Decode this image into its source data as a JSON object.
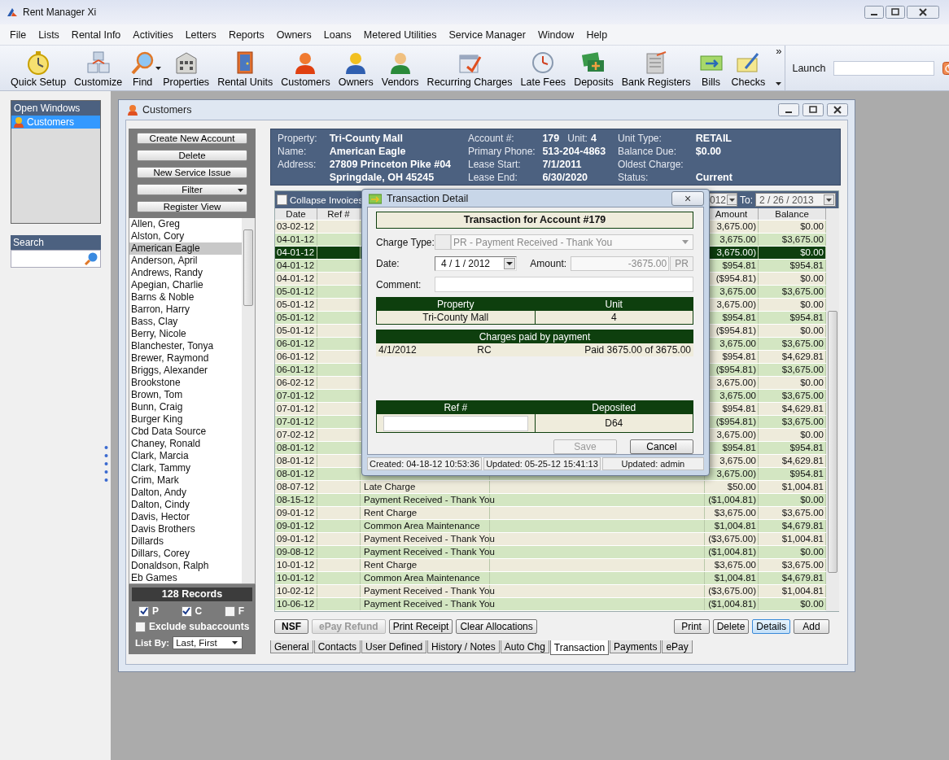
{
  "window": {
    "title": "Rent Manager Xi"
  },
  "menu": [
    "File",
    "Lists",
    "Rental Info",
    "Activities",
    "Letters",
    "Reports",
    "Owners",
    "Loans",
    "Metered Utilities",
    "Service Manager",
    "Window",
    "Help"
  ],
  "toolbar": [
    {
      "label": "Quick Setup",
      "has_menu": false
    },
    {
      "label": "Customize",
      "has_menu": false
    },
    {
      "label": "Find",
      "has_menu": true
    },
    {
      "label": "Properties",
      "has_menu": false
    },
    {
      "label": "Rental Units",
      "has_menu": false
    },
    {
      "label": "Customers",
      "has_menu": false
    },
    {
      "label": "Owners",
      "has_menu": false
    },
    {
      "label": "Vendors",
      "has_menu": false
    },
    {
      "label": "Recurring Charges",
      "has_menu": false
    },
    {
      "label": "Late Fees",
      "has_menu": false
    },
    {
      "label": "Deposits",
      "has_menu": false
    },
    {
      "label": "Bank Registers",
      "has_menu": false
    },
    {
      "label": "Bills",
      "has_menu": false
    },
    {
      "label": "Checks",
      "has_menu": false
    }
  ],
  "toolbar_overflow": "»",
  "launch": {
    "label": "Launch"
  },
  "open_windows": {
    "title": "Open Windows",
    "items": [
      {
        "label": "Customers",
        "selected": true
      }
    ]
  },
  "search": {
    "title": "Search"
  },
  "customers_window": {
    "title": "Customers",
    "actions": [
      {
        "label": "Create New Account",
        "has_menu": false
      },
      {
        "label": "Delete",
        "has_menu": false
      },
      {
        "label": "New Service Issue",
        "has_menu": false
      },
      {
        "label": "Filter",
        "has_menu": true
      },
      {
        "label": "Register View",
        "has_menu": false
      }
    ],
    "customer_list": [
      {
        "name": "Allen, Greg",
        "selected": false
      },
      {
        "name": "Alston, Cory",
        "selected": false
      },
      {
        "name": "American Eagle",
        "selected": true
      },
      {
        "name": "Anderson, April",
        "selected": false
      },
      {
        "name": "Andrews, Randy",
        "selected": false
      },
      {
        "name": "Apegian, Charlie",
        "selected": false
      },
      {
        "name": "Barns & Noble",
        "selected": false
      },
      {
        "name": "Barron, Harry",
        "selected": false
      },
      {
        "name": "Bass, Clay",
        "selected": false
      },
      {
        "name": "Berry, Nicole",
        "selected": false
      },
      {
        "name": "Blanchester, Tonya",
        "selected": false
      },
      {
        "name": "Brewer, Raymond",
        "selected": false
      },
      {
        "name": "Briggs, Alexander",
        "selected": false
      },
      {
        "name": "Brookstone",
        "selected": false
      },
      {
        "name": "Brown, Tom",
        "selected": false
      },
      {
        "name": "Bunn, Craig",
        "selected": false
      },
      {
        "name": "Burger King",
        "selected": false
      },
      {
        "name": "Cbd Data Source",
        "selected": false
      },
      {
        "name": "Chaney, Ronald",
        "selected": false
      },
      {
        "name": "Clark, Marcia",
        "selected": false
      },
      {
        "name": "Clark, Tammy",
        "selected": false
      },
      {
        "name": "Crim, Mark",
        "selected": false
      },
      {
        "name": "Dalton, Andy",
        "selected": false
      },
      {
        "name": "Dalton, Cindy",
        "selected": false
      },
      {
        "name": "Davis, Hector",
        "selected": false
      },
      {
        "name": "Davis Brothers",
        "selected": false
      },
      {
        "name": "Dillards",
        "selected": false
      },
      {
        "name": "Dillars, Corey",
        "selected": false
      },
      {
        "name": "Donaldson, Ralph",
        "selected": false
      },
      {
        "name": "Eb Games",
        "selected": false
      }
    ],
    "record_count": "128 Records",
    "filters": [
      {
        "label": "P",
        "checked": true
      },
      {
        "label": "C",
        "checked": true
      },
      {
        "label": "F",
        "checked": false
      }
    ],
    "exclude_subaccounts": {
      "label": "Exclude subaccounts",
      "checked": false
    },
    "list_by": {
      "label": "List By:",
      "value": "Last, First"
    },
    "account": [
      [
        {
          "label": "Property:",
          "value": "Tri-County Mall"
        },
        {
          "label": "Name:",
          "value": "American Eagle"
        },
        {
          "label": "Address:",
          "value": "27809 Princeton Pike #04"
        },
        {
          "value": "Springdale, OH 45245"
        }
      ],
      [
        {
          "label": "Account #:",
          "value": "179",
          "sub_label": "Unit:",
          "sub_value": "4"
        },
        {
          "label": "Primary Phone:",
          "value": "513-204-4863"
        },
        {
          "label": "Lease Start:",
          "value": "7/1/2011"
        },
        {
          "label": "Lease End:",
          "value": "6/30/2020"
        }
      ],
      [
        {
          "label": "Unit Type:",
          "value": "RETAIL"
        },
        {
          "label": "Balance Due:",
          "value": "$0.00"
        },
        {
          "label": "Oldest Charge:"
        },
        {
          "label": "Status:",
          "value": "Current"
        }
      ]
    ],
    "register": {
      "collapse_invoices": {
        "label": "Collapse Invoices",
        "checked": false
      },
      "from_date": "012",
      "to_label": "To:",
      "to_date": "2 / 26 / 2013",
      "columns": [
        "Date",
        "Ref #",
        "Amount",
        "Balance"
      ],
      "rows": [
        {
          "date": "03-02-12",
          "amount": "3,675.00)",
          "balance": "$0.00",
          "selected": false
        },
        {
          "date": "04-01-12",
          "amount": "3,675.00",
          "balance": "$3,675.00",
          "selected": false
        },
        {
          "date": "04-01-12",
          "amount": "3,675.00)",
          "balance": "$0.00",
          "selected": true
        },
        {
          "date": "04-01-12",
          "amount": "$954.81",
          "balance": "$954.81",
          "selected": false
        },
        {
          "date": "04-01-12",
          "amount": "($954.81)",
          "balance": "$0.00",
          "selected": false
        },
        {
          "date": "05-01-12",
          "amount": "3,675.00",
          "balance": "$3,675.00",
          "selected": false
        },
        {
          "date": "05-01-12",
          "amount": "3,675.00)",
          "balance": "$0.00",
          "selected": false
        },
        {
          "date": "05-01-12",
          "amount": "$954.81",
          "balance": "$954.81",
          "selected": false
        },
        {
          "date": "05-01-12",
          "amount": "($954.81)",
          "balance": "$0.00",
          "selected": false
        },
        {
          "date": "06-01-12",
          "amount": "3,675.00",
          "balance": "$3,675.00",
          "selected": false
        },
        {
          "date": "06-01-12",
          "amount": "$954.81",
          "balance": "$4,629.81",
          "selected": false
        },
        {
          "date": "06-01-12",
          "amount": "($954.81)",
          "balance": "$3,675.00",
          "selected": false
        },
        {
          "date": "06-02-12",
          "amount": "3,675.00)",
          "balance": "$0.00",
          "selected": false
        },
        {
          "date": "07-01-12",
          "amount": "3,675.00",
          "balance": "$3,675.00",
          "selected": false
        },
        {
          "date": "07-01-12",
          "amount": "$954.81",
          "balance": "$4,629.81",
          "selected": false
        },
        {
          "date": "07-01-12",
          "amount": "($954.81)",
          "balance": "$3,675.00",
          "selected": false
        },
        {
          "date": "07-02-12",
          "amount": "3,675.00)",
          "balance": "$0.00",
          "selected": false
        },
        {
          "date": "08-01-12",
          "amount": "$954.81",
          "balance": "$954.81",
          "selected": false
        },
        {
          "date": "08-01-12",
          "amount": "3,675.00",
          "balance": "$4,629.81",
          "selected": false
        },
        {
          "date": "08-01-12",
          "amount": "3,675.00)",
          "balance": "$954.81",
          "selected": false
        },
        {
          "date": "08-07-12",
          "description": "Late Charge",
          "amount": "$50.00",
          "balance": "$1,004.81",
          "selected": false
        },
        {
          "date": "08-15-12",
          "description": "Payment Received - Thank You",
          "amount": "($1,004.81)",
          "balance": "$0.00",
          "selected": false
        },
        {
          "date": "09-01-12",
          "description": "Rent Charge",
          "amount": "$3,675.00",
          "balance": "$3,675.00",
          "selected": false
        },
        {
          "date": "09-01-12",
          "description": "Common Area Maintenance",
          "amount": "$1,004.81",
          "balance": "$4,679.81",
          "selected": false
        },
        {
          "date": "09-01-12",
          "description": "Payment Received - Thank You",
          "amount": "($3,675.00)",
          "balance": "$1,004.81",
          "selected": false
        },
        {
          "date": "09-08-12",
          "description": "Payment Received - Thank You",
          "amount": "($1,004.81)",
          "balance": "$0.00",
          "selected": false
        },
        {
          "date": "10-01-12",
          "description": "Rent Charge",
          "amount": "$3,675.00",
          "balance": "$3,675.00",
          "selected": false
        },
        {
          "date": "10-01-12",
          "description": "Common Area Maintenance",
          "amount": "$1,004.81",
          "balance": "$4,679.81",
          "selected": false
        },
        {
          "date": "10-02-12",
          "description": "Payment Received - Thank You",
          "amount": "($3,675.00)",
          "balance": "$1,004.81",
          "selected": false
        },
        {
          "date": "10-06-12",
          "description": "Payment Received - Thank You",
          "amount": "($1,004.81)",
          "balance": "$0.00",
          "selected": false
        }
      ]
    },
    "buttons_left": [
      {
        "label": "NSF",
        "bold": true,
        "disabled": false
      },
      {
        "label": "ePay Refund",
        "bold": true,
        "disabled": true
      },
      {
        "label": "Print Receipt",
        "bold": false,
        "disabled": false
      },
      {
        "label": "Clear Allocations",
        "bold": false,
        "disabled": false
      }
    ],
    "buttons_right": [
      {
        "label": "Print",
        "focused": false
      },
      {
        "label": "Delete",
        "focused": false
      },
      {
        "label": "Details",
        "focused": true
      },
      {
        "label": "Add",
        "focused": false
      }
    ],
    "tabs": [
      {
        "label": "General",
        "selected": false
      },
      {
        "label": "Contacts",
        "selected": false
      },
      {
        "label": "User Defined",
        "selected": false
      },
      {
        "label": "History / Notes",
        "selected": false
      },
      {
        "label": "Auto Chg",
        "selected": false
      },
      {
        "label": "Transaction",
        "selected": true
      },
      {
        "label": "Payments",
        "selected": false
      },
      {
        "label": "ePay",
        "selected": false
      }
    ]
  },
  "transaction_dialog": {
    "title": "Transaction Detail",
    "close": "×",
    "heading": "Transaction for Account #179",
    "charge_type": {
      "label": "Charge Type:",
      "value": "PR - Payment Received - Thank You",
      "disabled": true
    },
    "date": {
      "label": "Date:",
      "value": "4 / 1 / 2012"
    },
    "amount": {
      "label": "Amount:",
      "value": "-3675.00",
      "code": "PR",
      "disabled": true
    },
    "comment": {
      "label": "Comment:"
    },
    "property_table": {
      "columns": [
        "Property",
        "Unit"
      ],
      "row": [
        "Tri-County Mall",
        "4"
      ]
    },
    "charges_table": {
      "title": "Charges paid by payment",
      "rows": [
        [
          "4/1/2012",
          "RC",
          "Paid 3675.00 of 3675.00"
        ]
      ]
    },
    "deposit_table": {
      "columns": [
        "Ref #",
        "Deposited"
      ],
      "deposited": "D64"
    },
    "buttons": [
      {
        "label": "Save",
        "disabled": true
      },
      {
        "label": "Cancel",
        "disabled": false
      }
    ],
    "status": [
      "Created: 04-18-12 10:53:36",
      "Updated: 05-25-12 15:41:13",
      "Updated: admin"
    ]
  }
}
